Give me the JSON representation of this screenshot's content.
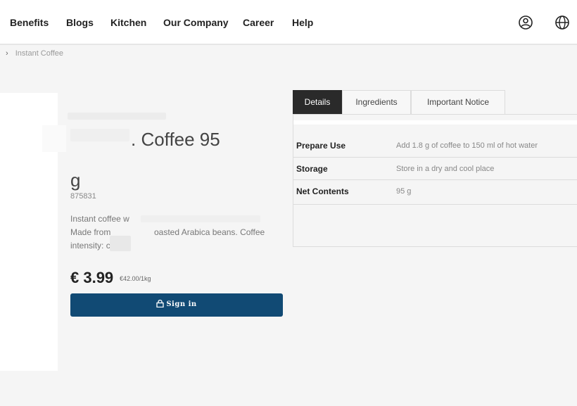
{
  "nav": {
    "links": [
      "Benefits",
      "Blogs",
      "Kitchen",
      "Our Company",
      "Career",
      "Help"
    ],
    "icons": [
      "user-circle-icon",
      "globe-icon"
    ]
  },
  "breadcrumb": {
    "current": "Instant Coffee"
  },
  "product": {
    "title_line1": ". Coffee 95",
    "title_line2": "g",
    "sku": "875831",
    "description_line1": "Instant coffee w",
    "description_line2_a": "Made from",
    "description_line2_b": "oasted Arabica beans. Coffee",
    "description_line3": "intensity: c",
    "price": "€ 3.99",
    "unit_price": "€42.00/1kg",
    "signin_label": "Sign in"
  },
  "tabs": [
    "Details",
    "Ingredients",
    "Important Notice"
  ],
  "details": [
    {
      "label": "Prepare Use",
      "value": "Add 1.8 g of coffee to 150 ml of hot water"
    },
    {
      "label": "Storage",
      "value": "Store in a dry and cool place"
    },
    {
      "label": "Net Contents",
      "value": "95 g"
    }
  ],
  "colors": {
    "button_bg": "#114a74",
    "active_tab_bg": "#2a2a2a",
    "page_bg": "#f5f5f5"
  }
}
